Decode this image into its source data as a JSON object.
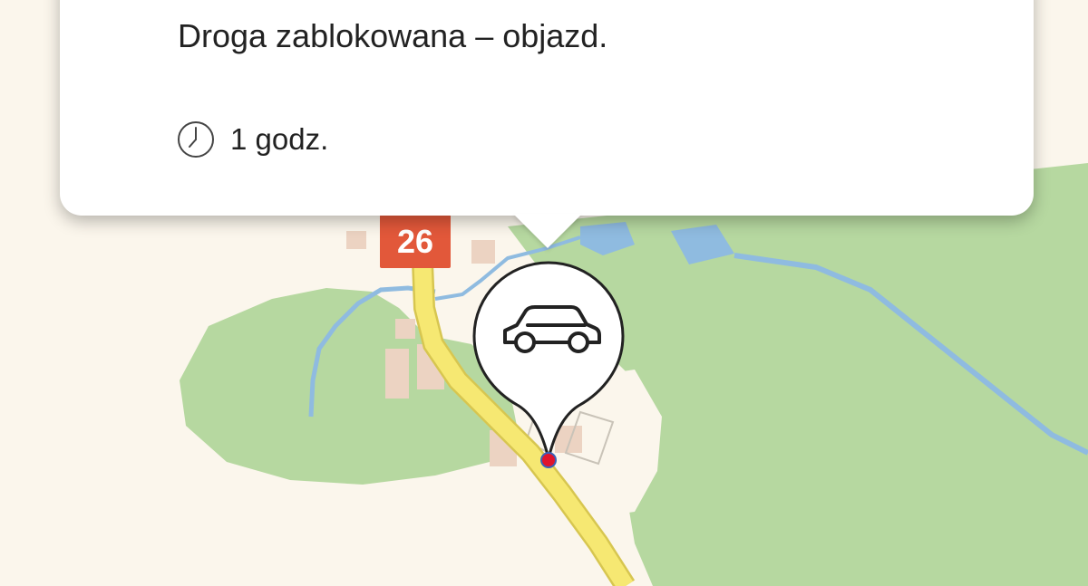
{
  "popup": {
    "message": "Droga zablokowana – objazd.",
    "duration": "1 godz.",
    "duration_icon": "clock-icon"
  },
  "map": {
    "road_number": "26",
    "marker_icon": "car-icon",
    "colors": {
      "background": "#fbf6ec",
      "forest": "#b6d8a0",
      "water": "#8fbbe0",
      "road": "#f6e872",
      "road_shield": "#e2583a",
      "buildings": "#ecd3c2",
      "marker_dot": "#e0142c"
    }
  }
}
